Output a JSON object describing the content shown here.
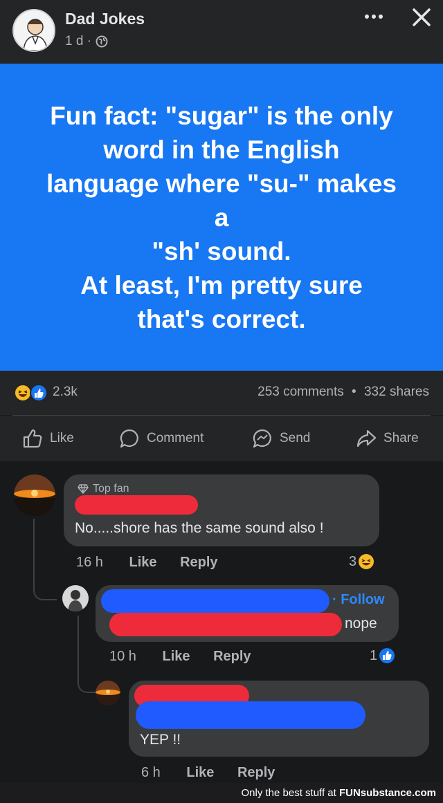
{
  "header": {
    "page_name": "Dad Jokes",
    "time": "1 d ·",
    "more_icon": "ellipsis-icon",
    "close_icon": "close-icon"
  },
  "post": {
    "text": "Fun fact: \"sugar\" is the only\nword in the English\nlanguage where \"su-\" makes\na\n\"sh' sound.\nAt least, I'm pretty sure\nthat's correct.",
    "background_color": "#1877f2"
  },
  "stats": {
    "reaction_count": "2.3k",
    "comments": "253 comments",
    "separator": "•",
    "shares": "332 shares"
  },
  "actions": {
    "like": "Like",
    "comment": "Comment",
    "send": "Send",
    "share": "Share"
  },
  "comments": [
    {
      "badge": "Top fan",
      "text": "No.....shore has the same sound also !",
      "time": "16 h",
      "like": "Like",
      "reply": "Reply",
      "reactions": "3"
    },
    {
      "follow": "· Follow",
      "text": "nope",
      "time": "10 h",
      "like": "Like",
      "reply": "Reply",
      "reactions": "1"
    },
    {
      "text": "YEP !!",
      "time": "6 h",
      "like": "Like",
      "reply": "Reply"
    }
  ],
  "watermark": {
    "prefix": "Only the best stuff at ",
    "brand": "FUNsubstance.com"
  }
}
